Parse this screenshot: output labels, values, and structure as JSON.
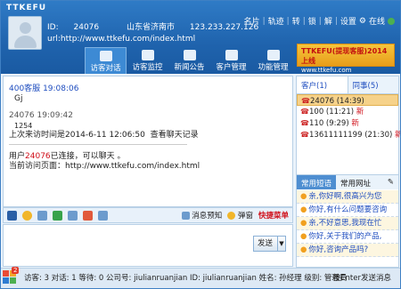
{
  "app": {
    "title": "TTKEFU"
  },
  "top_menu": [
    "名片",
    "轨迹",
    "转",
    "锁",
    "解",
    "设置",
    "在线"
  ],
  "visitor": {
    "id_label": "ID:",
    "id": "24076",
    "location": "山东省济南市",
    "ip": "123.233.227.126",
    "url": "url:http://www.ttkefu.com/index.html"
  },
  "nav": [
    "访客对话",
    "访客监控",
    "新闻公告",
    "客户管理",
    "功能管理"
  ],
  "promo": {
    "line1": "TTKEFU(提现客服)2014上线",
    "line2": "www.ttkefu.com"
  },
  "chat": {
    "msg1_sender": "400客服",
    "msg1_time": "19:08:06",
    "msg1_text": "Gj",
    "msg2_sender": "24076",
    "msg2_time": "19:09:42",
    "msg2_text": "1254",
    "last_visit": "上次来访时间是2014-6-11 12:06:50",
    "view_history": "查看聊天记录",
    "connected_prefix": "用户",
    "connected_id": "24076",
    "connected_suffix": "已连接，可以聊天 。",
    "current_page": "当前访问页面：http://www.ttkefu.com/index.html"
  },
  "toolbar": {
    "preview": "消息预知",
    "popup": "弹窗",
    "shortcut": "快捷菜单"
  },
  "send_label": "发送",
  "right_panel": {
    "tab_customers": "客户(1)",
    "tab_colleagues": "同事(5)",
    "sessions": [
      {
        "label": "24076 (14:39)",
        "new": ""
      },
      {
        "label": "100 (11:21)",
        "new": "新"
      },
      {
        "label": "110 (9:29)",
        "new": "新"
      },
      {
        "label": "13611111199 (21:30)",
        "new": "新"
      }
    ],
    "quick_tab_phrases": "常用短语",
    "quick_tab_urls": "常用网址",
    "phrases": [
      "亲,你好啊,很高兴为您",
      "你好,有什么问题要咨询",
      "亲,不好意思,我现在忙",
      "你好,关于我们的产品,",
      "你好,咨询产品吗?"
    ]
  },
  "status": {
    "text": "访客: 3 对话: 1 等待: 0 公司号: jiulianruanjian ID: jiulianruanjian 姓名: 孙经理 级别: 管理员",
    "right": "按Enter发送消息",
    "badge": "2"
  }
}
